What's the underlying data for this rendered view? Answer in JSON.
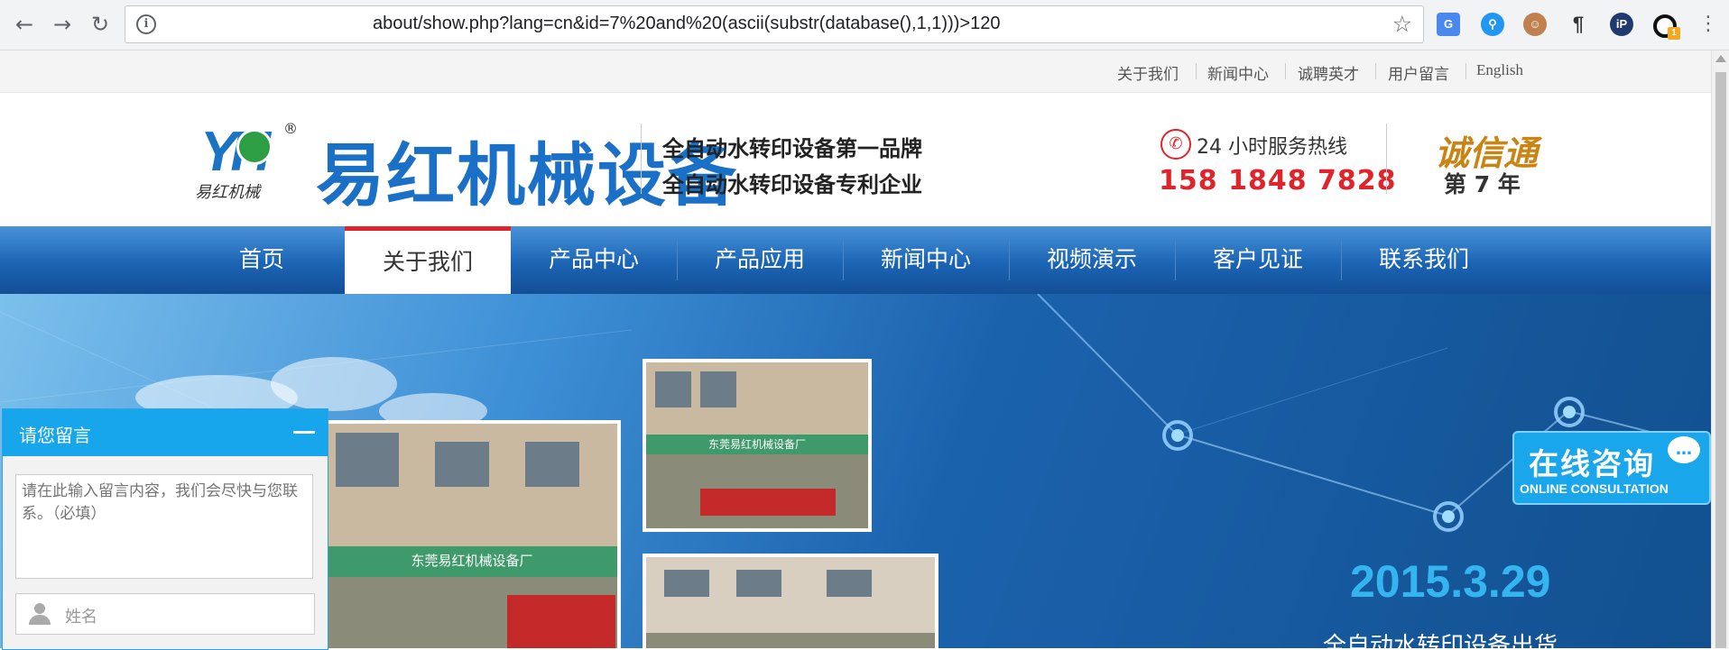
{
  "browser": {
    "url": "about/show.php?lang=cn&id=7%20and%20(ascii(substr(database(),1,1)))>120",
    "nav_icons": [
      "back-arrow-icon",
      "forward-arrow-icon",
      "reload-icon"
    ],
    "extensions": [
      "google-translate-icon",
      "search-extension-icon",
      "ghostery-icon",
      "pilcrow-extension-icon",
      "ip-extension-icon",
      "circle-extension-icon",
      "chrome-menu-icon"
    ],
    "ext_badge": "1"
  },
  "top_links": [
    "关于我们",
    "新闻中心",
    "诚聘英才",
    "用户留言",
    "English"
  ],
  "header": {
    "logo_letters": "YH",
    "logo_sub": "易红机械",
    "brand_name": "易红机械设备",
    "slogan_1": "全自动水转印设备第一品牌",
    "slogan_2": "全自动水转印设备专利企业",
    "hotline_label": "24 小时服务热线",
    "phone": "158 1848 7828",
    "chengxintong": "诚信通",
    "year_label": "第 7 年"
  },
  "nav": {
    "items": [
      "首页",
      "关于我们",
      "产品中心",
      "产品应用",
      "新闻中心",
      "视频演示",
      "客户见证",
      "联系我们"
    ],
    "active_index": 1
  },
  "banner": {
    "date": "2015.3.29",
    "caption": "全自动水转印设备出货",
    "photo_label_1": "东莞易红机械设备厂",
    "photo_label_2": "东莞易红机械设备厂"
  },
  "message_box": {
    "title": "请您留言",
    "content_placeholder": "请在此输入留言内容，我们会尽快与您联系。（必填）",
    "name_placeholder": "姓名"
  },
  "consult": {
    "label_cn": "在线咨询",
    "label_en": "ONLINE CONSULTATION"
  },
  "colors": {
    "brand_blue": "#1a6fc7",
    "nav_blue": "#1b64b4",
    "accent_red": "#e0242b",
    "widget_blue": "#17a6ec"
  }
}
